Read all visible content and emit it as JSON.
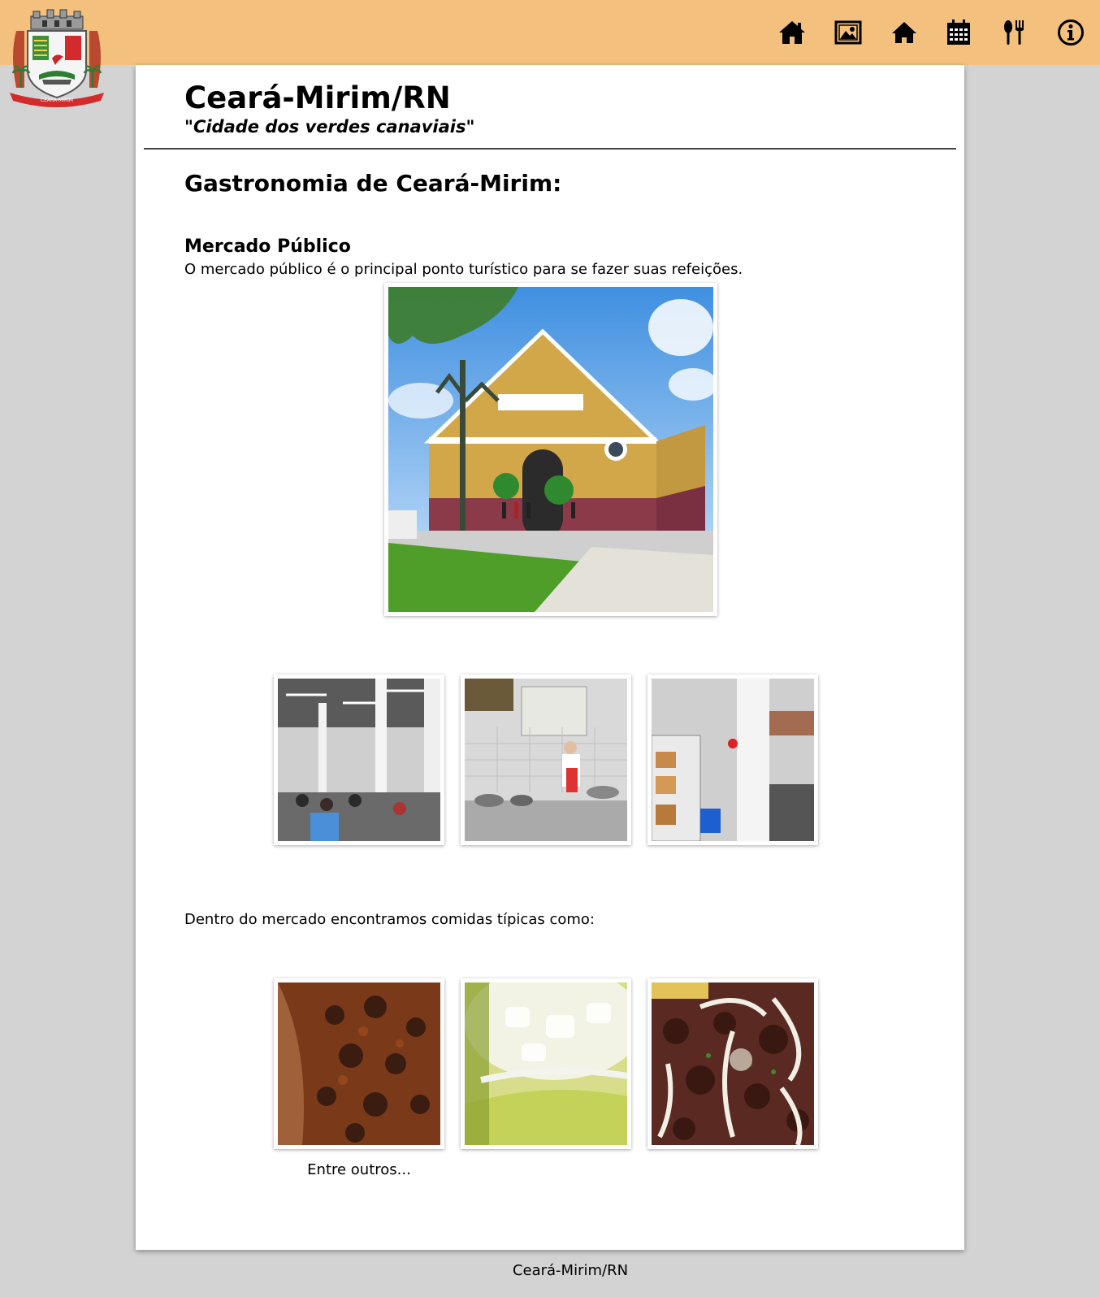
{
  "header": {
    "logo_icon": "city-coat-of-arms-icon",
    "nav": [
      {
        "icon": "home-icon"
      },
      {
        "icon": "gallery-icon"
      },
      {
        "icon": "house-icon"
      },
      {
        "icon": "calendar-icon"
      },
      {
        "icon": "restaurant-icon"
      },
      {
        "icon": "info-icon"
      }
    ]
  },
  "site": {
    "title": "Ceará-Mirim/RN",
    "slogan": "\"Cidade dos verdes canaviais\""
  },
  "page": {
    "title": "Gastronomia de Ceará-Mirim:",
    "section_title": "Mercado Público",
    "section_text": "O mercado público é o principal ponto turístico para se fazer suas refeições.",
    "foods_text": "Dentro do mercado encontramos comidas típicas como:",
    "caption": "Entre outros..."
  },
  "footer": {
    "text": "Ceará-Mirim/RN"
  },
  "colors": {
    "topbar": "#f3c07d",
    "background": "#d3d3d3",
    "sheet": "#ffffff"
  }
}
